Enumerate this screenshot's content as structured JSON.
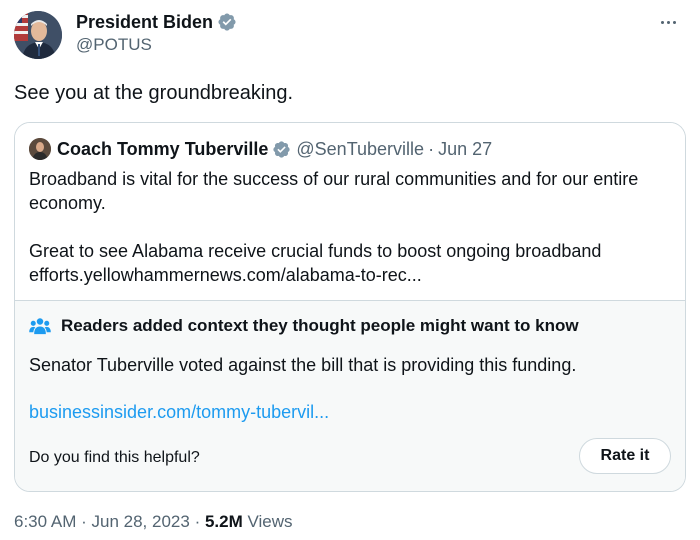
{
  "tweet": {
    "author_name": "President Biden",
    "author_handle": "@POTUS",
    "text": "See you at the groundbreaking."
  },
  "quoted_tweet": {
    "author_name": "Coach Tommy Tuberville",
    "author_handle": "@SenTuberville",
    "separator": "·",
    "date": "Jun 27",
    "text_line1": "Broadband is vital for the success of our rural communities and for our entire",
    "text_line2": "economy.",
    "text_line3": "Great to see Alabama receive crucial funds to boost ongoing broadband",
    "text_line4": "efforts.yellowhammernews.com/alabama-to-rec..."
  },
  "community_note": {
    "title": "Readers added context they thought people might want to know",
    "body": "Senator Tuberville voted against the bill that is providing this funding.",
    "link": "businessinsider.com/tommy-tubervil...",
    "question": "Do you find this helpful?",
    "rate_label": "Rate it"
  },
  "meta": {
    "time": "6:30 AM",
    "separator": "·",
    "date": "Jun 28, 2023",
    "views_count": "5.2M",
    "views_label": "Views"
  },
  "icons": {
    "verified": "verified-badge-icon",
    "more": "more-options-icon",
    "note": "community-notes-icon"
  },
  "colors": {
    "verified_badge": "#829aab",
    "link": "#1d9bf0",
    "note_icon": "#1d9bf0",
    "secondary_text": "#536471",
    "border": "#cfd9de",
    "note_background": "#f7f9f9"
  }
}
